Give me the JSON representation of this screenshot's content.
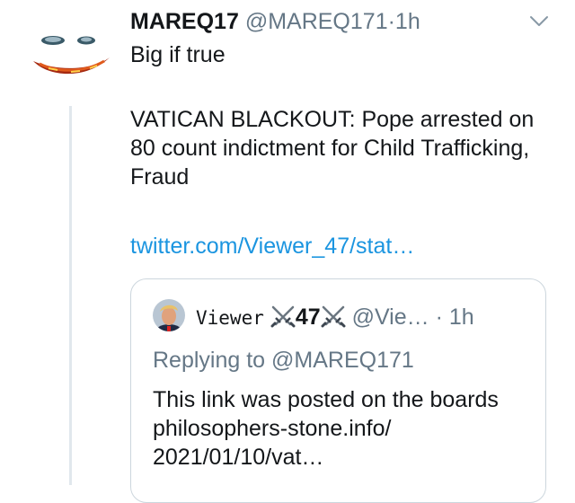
{
  "tweet": {
    "name": "MAREQ17",
    "handle": "@MAREQ171",
    "dot": "·",
    "time": "1h",
    "text_line1": "Big if true",
    "text_body": "VATICAN BLACKOUT: Pope arrested on 80 count indictment for Child Trafficking, Fraud",
    "link": "twitter.com/Viewer_47/stat…",
    "avatar_icon": "joker-smile-icon",
    "menu_icon": "chevron-down-icon"
  },
  "quote": {
    "name_prefix": "Viewer",
    "name_number": "47",
    "handle": "@Vie…",
    "dot": "·",
    "time": "1h",
    "replying_label": "Replying to",
    "replying_mention": "@MAREQ171",
    "text": "This link was posted on the boards philosophers-stone.info/ 2021/01/10/vat…",
    "name_icons": [
      "crossed-swords-icon",
      "crossed-swords-icon"
    ]
  },
  "colors": {
    "text": "#14171a",
    "secondary": "#657786",
    "link": "#1b95e0",
    "border": "#ccd6dd",
    "thread_line": "#e1e8ed"
  }
}
